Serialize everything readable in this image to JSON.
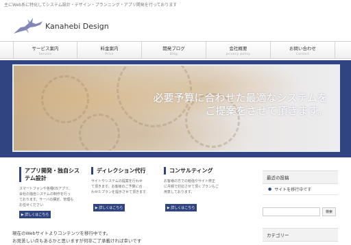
{
  "site": {
    "tagline": "主にWeb系に特化してシステム設計・デザイン・プランニング・アプリ開発を行っております",
    "logo_text": "Kanahebi Design"
  },
  "nav": [
    {
      "label": "サービス案内",
      "sub": "Service"
    },
    {
      "label": "料金案内",
      "sub": "Price"
    },
    {
      "label": "開発ブログ",
      "sub": "Blog"
    },
    {
      "label": "会社概要",
      "sub": "privacy policy"
    },
    {
      "label": "お問い合わせ",
      "sub": "Contact"
    }
  ],
  "hero": {
    "line1": "必要予算に合わせた最適なシステムを",
    "line2": "ご提案をさせて頂きます。"
  },
  "columns": [
    {
      "title_line1": "アプリ開発・独自シス",
      "title_line2": "テム設計",
      "body": [
        "スマートフォンや各種OSアプリ、",
        "会社の独自システムの制作を行っ",
        "ております。サーバの構定、管理も",
        "お任せください"
      ],
      "button": "▶ 詳しくはこちら"
    },
    {
      "title_line1": "ディレクション代行",
      "title_line2": "",
      "body": [
        "サイトやシステムの提案を行わせ",
        "て頂きます。お客様のご予算に合",
        "わせたプランを提示させて頂きます"
      ],
      "button": "▶ 詳しくはこちら"
    },
    {
      "title_line1": "コンサルティング",
      "title_line2": "",
      "body": [
        "お客様の方での勉強やサイト修正",
        "に月額で対応させて頂くプランもご",
        "用意しております。"
      ],
      "button": "▶ 詳しくはこちら"
    }
  ],
  "sidebar": {
    "recent_heading": "最近の投稿",
    "recent_items": [
      "サイトを移行中です"
    ],
    "search_button": "検索",
    "category_heading": "カテゴリー"
  },
  "notice": {
    "line1": "現在のWebサイトよりコンテンツを移行中です。",
    "line2": "お見苦しい点もあるかと思いますが何卒ご了承載ければ幸いです"
  },
  "colors": {
    "brand_navy": "#2f4480"
  }
}
